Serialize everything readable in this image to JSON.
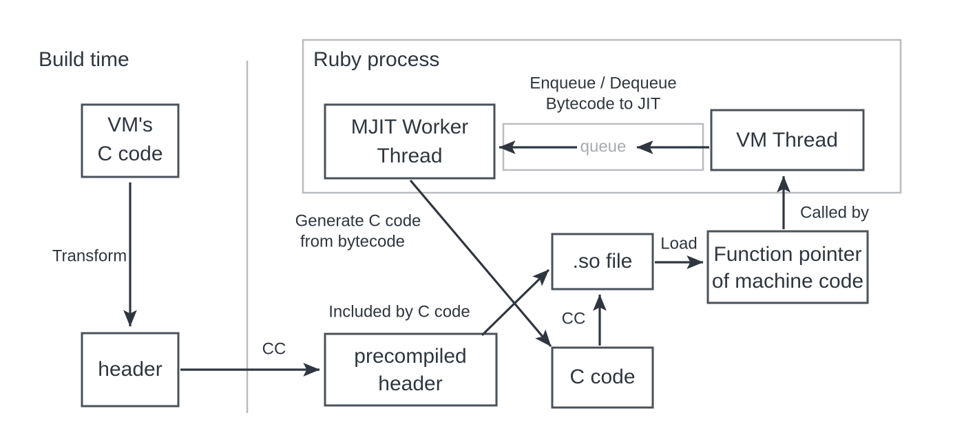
{
  "diagram": {
    "title_build_time": "Build time",
    "container": {
      "label": "Ruby process"
    },
    "boxes": {
      "vm_c_code_line1": "VM's",
      "vm_c_code_line2": "C code",
      "header": "header",
      "precompiled_header_line1": "precompiled",
      "precompiled_header_line2": "header",
      "mjit_worker_line1": "MJIT Worker",
      "mjit_worker_line2": "Thread",
      "vm_thread": "VM Thread",
      "queue": "queue",
      "so_file": ".so file",
      "c_code": "C code",
      "function_pointer_line1": "Function pointer",
      "function_pointer_line2": "of machine code"
    },
    "edge_labels": {
      "transform": "Transform",
      "cc_header": "CC",
      "cc_ccode": "CC",
      "load": "Load",
      "called_by": "Called by",
      "enqueue_line1": "Enqueue / Dequeue",
      "enqueue_line2": "Bytecode to JIT",
      "generate_line1": "Generate C code",
      "generate_line2": "from bytecode",
      "included_by": "Included by C code"
    },
    "colors": {
      "box_stroke": "#4a5159",
      "light_stroke": "#b9bcbf",
      "text": "#2f3640",
      "muted_text": "#a8abaf",
      "background": "#ffffff"
    }
  }
}
